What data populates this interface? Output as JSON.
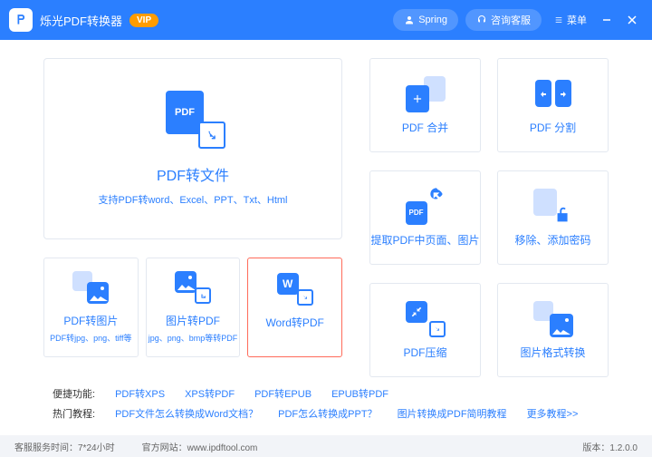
{
  "titlebar": {
    "app_name": "烁光PDF转换器",
    "vip": "VIP",
    "user": "Spring",
    "support": "咨询客服",
    "menu": "菜单"
  },
  "main_card": {
    "title": "PDF转文件",
    "subtitle": "支持PDF转word、Excel、PPT、Txt、Html"
  },
  "small_cards": [
    {
      "title": "PDF转图片",
      "subtitle": "PDF转jpg、png、tiff等"
    },
    {
      "title": "图片转PDF",
      "subtitle": "jpg、png、bmp等转PDF"
    },
    {
      "title": "Word转PDF",
      "subtitle": ""
    }
  ],
  "right_cards": [
    {
      "title": "PDF 合并"
    },
    {
      "title": "PDF 分割"
    },
    {
      "title": "提取PDF中页面、图片"
    },
    {
      "title": "移除、添加密码"
    },
    {
      "title": "PDF压缩"
    },
    {
      "title": "图片格式转换"
    }
  ],
  "links": {
    "row1_label": "便捷功能:",
    "row1": [
      "PDF转XPS",
      "XPS转PDF",
      "PDF转EPUB",
      "EPUB转PDF"
    ],
    "row2_label": "热门教程:",
    "row2": [
      "PDF文件怎么转换成Word文档？",
      "PDF怎么转换成PPT？",
      "图片转换成PDF简明教程",
      "更多教程>>"
    ]
  },
  "statusbar": {
    "hours": "客服服务时间：7*24小时",
    "site": "官方网站：www.ipdftool.com",
    "version": "版本：1.2.0.0"
  }
}
